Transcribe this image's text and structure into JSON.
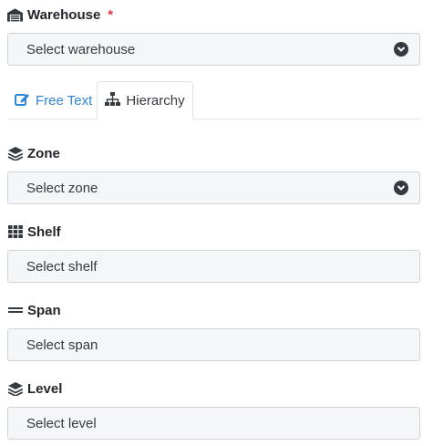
{
  "warehouse": {
    "label": "Warehouse",
    "required_mark": "*",
    "placeholder": "Select warehouse",
    "icon": "warehouse-icon"
  },
  "tabs": [
    {
      "label": "Free Text",
      "icon": "edit-icon",
      "active": false
    },
    {
      "label": "Hierarchy",
      "icon": "sitemap-icon",
      "active": true
    }
  ],
  "zone": {
    "label": "Zone",
    "placeholder": "Select zone",
    "icon": "layers-icon"
  },
  "shelf": {
    "label": "Shelf",
    "placeholder": "Select shelf",
    "icon": "grid-icon"
  },
  "span": {
    "label": "Span",
    "placeholder": "Select span",
    "icon": "equals-icon"
  },
  "level": {
    "label": "Level",
    "placeholder": "Select level",
    "icon": "layers-icon"
  },
  "colors": {
    "accent": "#2f86d6",
    "required": "#dc3545",
    "field_bg": "#f5f6f8",
    "field_border": "#ced4da"
  }
}
